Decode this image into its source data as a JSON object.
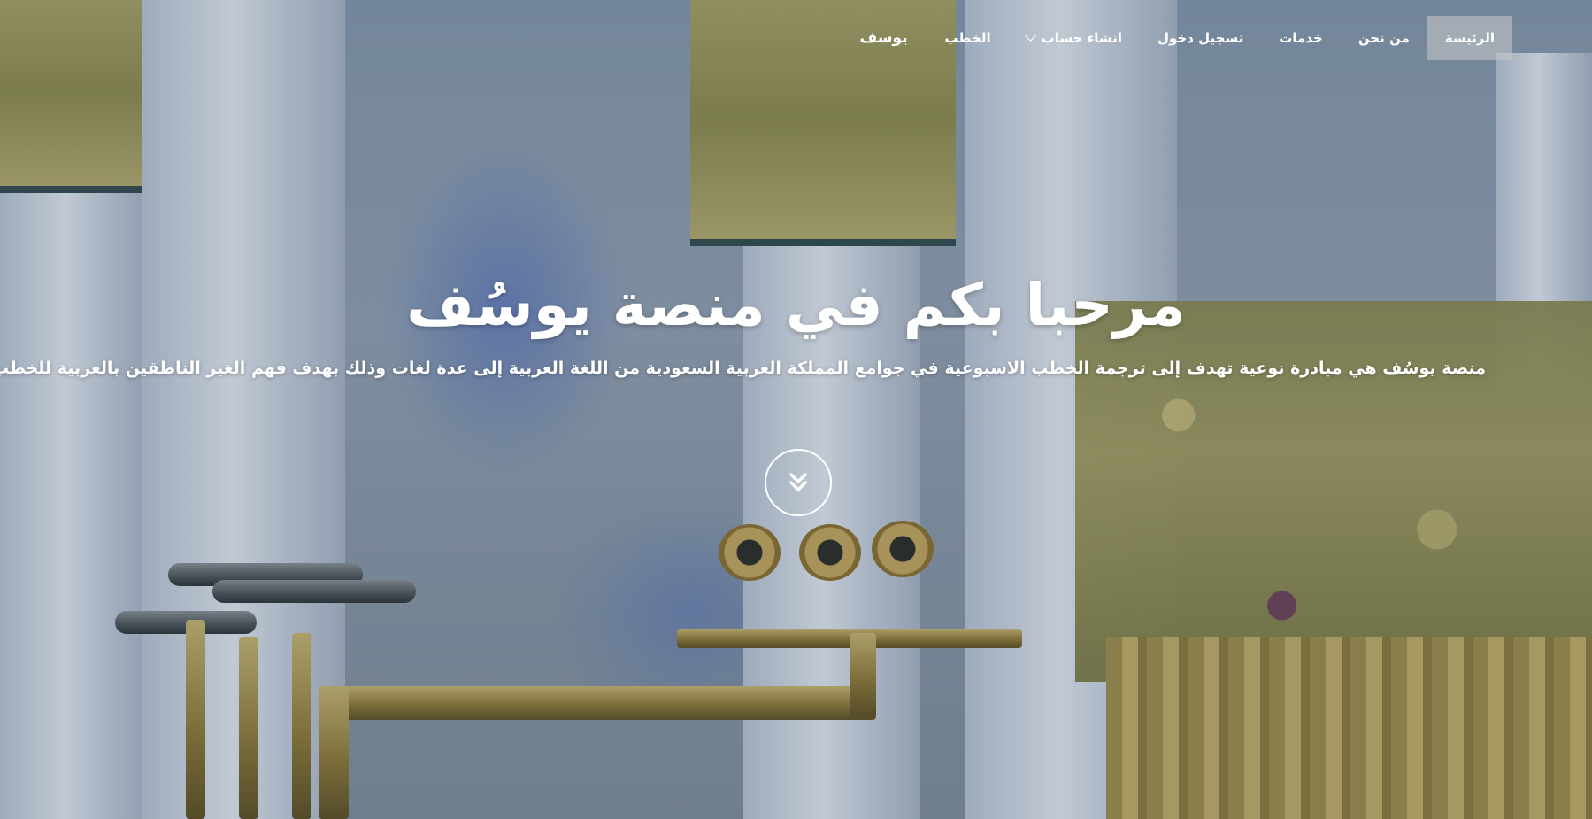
{
  "navbar": {
    "brand": "يوسف",
    "items": [
      {
        "label": "الرئيسة",
        "active": true
      },
      {
        "label": "من نحن",
        "active": false
      },
      {
        "label": "خدمات",
        "active": false
      },
      {
        "label": "تسجيل دخول",
        "active": false
      },
      {
        "label": "انشاء حساب",
        "active": false,
        "dropdown": true
      },
      {
        "label": "الخطب",
        "active": false
      }
    ]
  },
  "hero": {
    "title": "مرحبا بكم في منصة يوسُف",
    "subtitle": "منصة يوسُف هي مبادرة نوعية تهدف إلى ترجمة الخطب الاسبوعية في جوامع المملكة العربية السعودية من اللغة العربية إلى عدة لغات وذلك بهدف فهم الغير الناطقين بالعربية للخطب الاسبوعية",
    "scroll_icon": "double-chevron-down-icon"
  },
  "colors": {
    "text": "#ffffff",
    "active_nav_bg": "rgba(200,200,200,0.55)"
  }
}
